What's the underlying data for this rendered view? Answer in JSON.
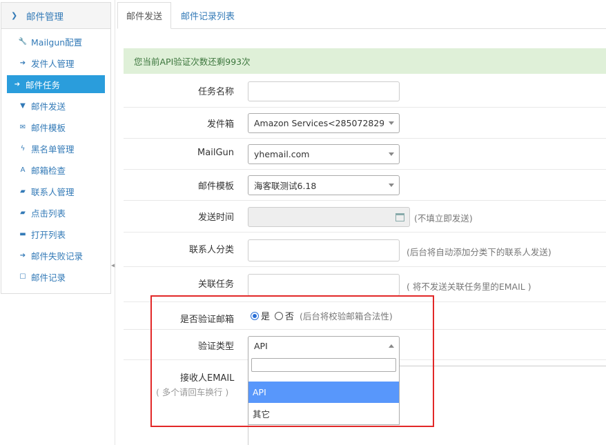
{
  "sidebar": {
    "title": "邮件管理",
    "items": [
      {
        "label": "Mailgun配置",
        "icon": "wrench-icon",
        "glyph": "🔧"
      },
      {
        "label": "发件人管理",
        "icon": "arrow-circle-icon",
        "glyph": "➔"
      },
      {
        "label": "邮件任务",
        "icon": "arrow-circle-icon",
        "glyph": "➔",
        "active": true
      },
      {
        "label": "邮件发送",
        "icon": "filter-icon",
        "glyph": "▼"
      },
      {
        "label": "邮件模板",
        "icon": "envelope-icon",
        "glyph": "✉"
      },
      {
        "label": "黑名单管理",
        "icon": "bolt-icon",
        "glyph": "ϟ"
      },
      {
        "label": "邮箱检查",
        "icon": "road-icon",
        "glyph": "A"
      },
      {
        "label": "联系人管理",
        "icon": "book-icon",
        "glyph": "▰"
      },
      {
        "label": "点击列表",
        "icon": "book-icon",
        "glyph": "▰"
      },
      {
        "label": "打开列表",
        "icon": "folder-open-icon",
        "glyph": "▬"
      },
      {
        "label": "邮件失败记录",
        "icon": "arrow-circle-icon",
        "glyph": "➔"
      },
      {
        "label": "邮件记录",
        "icon": "square-icon",
        "glyph": "☐"
      }
    ]
  },
  "tabs": [
    "邮件发送",
    "邮件记录列表"
  ],
  "alert": "您当前API验证次数还剩993次",
  "form": {
    "task_name_label": "任务名称",
    "mailbox_label": "发件箱",
    "mailbox_value": "Amazon Services<285072829…",
    "mailgun_label": "MailGun",
    "mailgun_value": "yhemail.com",
    "template_label": "邮件模板",
    "template_value": "海客联测试6.18",
    "send_time_label": "发送时间",
    "send_time_help": "(不填立即发送)",
    "contact_cat_label": "联系人分类",
    "contact_cat_help": "(后台将自动添加分类下的联系人发送)",
    "related_task_label": "关联任务",
    "related_task_help": "( 将不发送关联任务里的EMAIL )",
    "verify_label": "是否验证邮箱",
    "verify_yes": "是",
    "verify_no": "否",
    "verify_help": "(后台将校验邮箱合法性)",
    "verify_type_label": "验证类型",
    "verify_type_value": "API",
    "verify_type_options": [
      "API",
      "其它"
    ],
    "receiver_label": "接收人EMAIL",
    "receiver_hint": "( 多个请回车换行 )"
  }
}
